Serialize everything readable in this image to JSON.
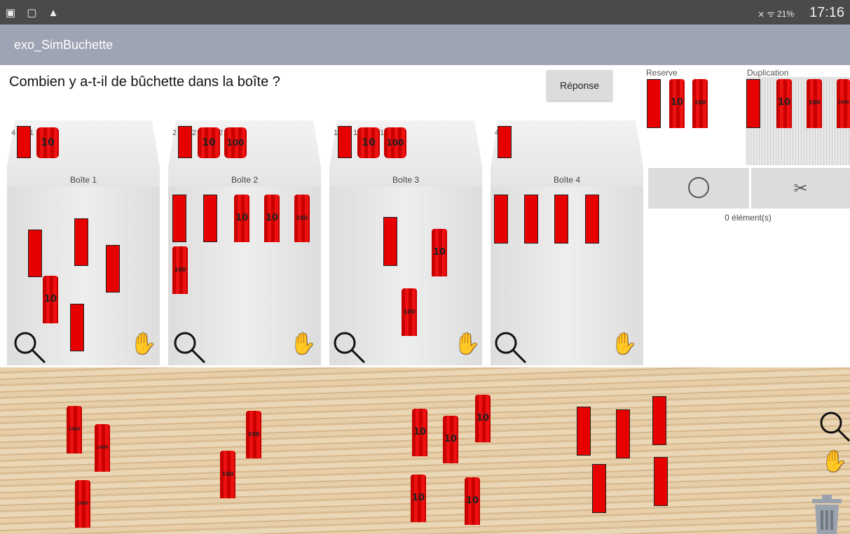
{
  "status": {
    "left_icons": "▣ ▢ ▲",
    "sys": "⨯ ᯤ 21%",
    "time": "17:16"
  },
  "app": {
    "title": "exo_SimBuchette"
  },
  "question": "Combien y a-t-il de bûchette dans la boîte ?",
  "reponse_label": "Réponse",
  "panel": {
    "reserve_label": "Reserve",
    "duplication_label": "Duplication",
    "count_text": "0 élément(s)"
  },
  "boxes": [
    {
      "name": "Boîte 1",
      "c1": "4",
      "c2": "1"
    },
    {
      "name": "Boîte 2",
      "c1": "2",
      "c2": "2",
      "c3": "2"
    },
    {
      "name": "Boîte 3",
      "c1": "1",
      "c2": "1",
      "c3": "1"
    },
    {
      "name": "Boîte 4",
      "c1": "4"
    }
  ],
  "labels": {
    "ten": "10",
    "hundred": "100",
    "thousand": "1000"
  },
  "icons": {
    "search": "search-icon",
    "hand": "hand-icon",
    "circle": "circle-icon",
    "scissors": "scissors-icon",
    "trash": "trash-icon"
  }
}
